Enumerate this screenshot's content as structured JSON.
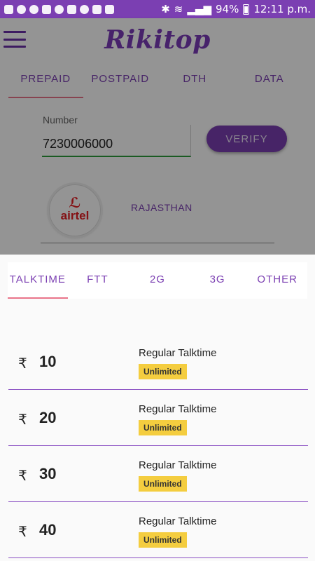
{
  "status_bar": {
    "battery": "94%",
    "time": "12:11 p.m.",
    "color": "#7b3fb2"
  },
  "header": {
    "logo_text": "Rikitop",
    "menu_icon": "hamburger-icon"
  },
  "recharge_tabs": [
    {
      "label": "PREPAID",
      "active": true
    },
    {
      "label": "POSTPAID",
      "active": false
    },
    {
      "label": "DTH",
      "active": false
    },
    {
      "label": "DATA",
      "active": false
    }
  ],
  "number_form": {
    "label": "Number",
    "value": "7230006000",
    "verify_label": "VERIFY"
  },
  "operator": {
    "logo_text": "airtel",
    "circle": "RAJASTHAN"
  },
  "plan_tabs": [
    {
      "label": "TALKTIME",
      "active": true
    },
    {
      "label": "FTT",
      "active": false
    },
    {
      "label": "2G",
      "active": false
    },
    {
      "label": "3G",
      "active": false
    },
    {
      "label": "OTHER",
      "active": false
    }
  ],
  "plans": [
    {
      "currency": "₹",
      "amount": "10",
      "description": "Regular Talktime",
      "validity": "Unlimited"
    },
    {
      "currency": "₹",
      "amount": "20",
      "description": "Regular Talktime",
      "validity": "Unlimited"
    },
    {
      "currency": "₹",
      "amount": "30",
      "description": "Regular Talktime",
      "validity": "Unlimited"
    },
    {
      "currency": "₹",
      "amount": "40",
      "description": "Regular Talktime",
      "validity": "Unlimited"
    }
  ],
  "colors": {
    "accent": "#7b3fb2",
    "tab_indicator": "#e9748a",
    "badge": "#f4cd3f",
    "input_focus": "#2e9d3c"
  }
}
